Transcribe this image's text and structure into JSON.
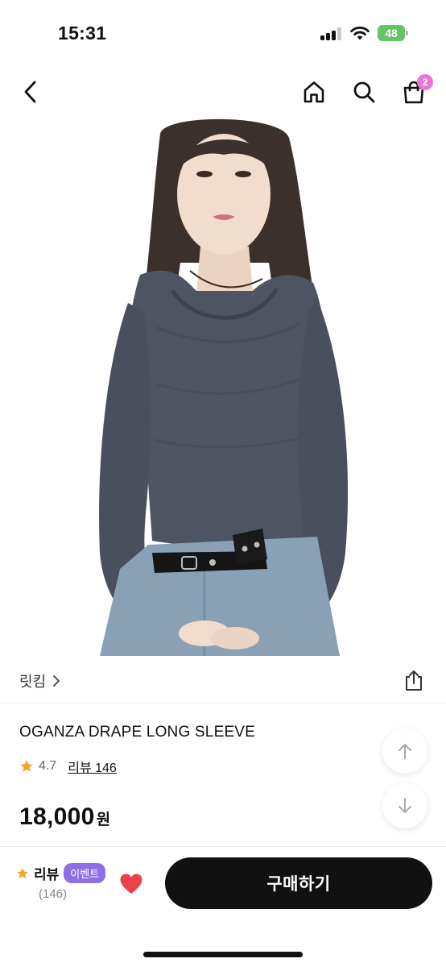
{
  "status_bar": {
    "time": "15:31",
    "battery": "48",
    "icons": [
      "cellular-signal-icon",
      "wifi-icon",
      "battery-charging-icon"
    ]
  },
  "nav": {
    "icons": [
      "back-chevron-icon",
      "home-icon",
      "search-icon",
      "shopping-bag-icon"
    ],
    "cart_count": "2",
    "cart_badge_color": "#e876d8"
  },
  "product": {
    "image_alt": "woman-in-gray-draped-long-sleeve-top",
    "brand": "릿킴",
    "name": "OGANZA DRAPE LONG SLEEVE",
    "rating": "4.7",
    "review_link": "리뷰 146",
    "price": "18,000",
    "price_unit": "원",
    "top_color": "#4f5463",
    "jeans_color": "#8aa0b5",
    "star_color": "#f5a524"
  },
  "float_buttons": {
    "icons": [
      "arrow-up-icon",
      "arrow-down-icon"
    ]
  },
  "bottom_bar": {
    "review_label": "리뷰",
    "event_badge": "이벤트",
    "review_count": "(146)",
    "buy_label": "구매하기",
    "heart_color": "#e8424d",
    "event_badge_color": "#8f6ee6"
  }
}
